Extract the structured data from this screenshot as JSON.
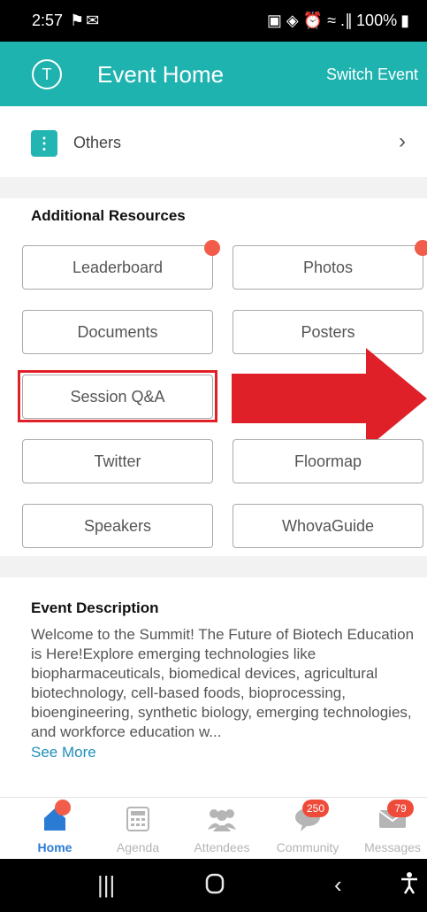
{
  "status_bar": {
    "time": "2:57",
    "left_icons": "⚑✉",
    "right_icons": "▣ ◈ ⏰ ≈ .∥",
    "battery": "100%"
  },
  "header": {
    "avatar_letter": "T",
    "title": "Event Home",
    "switch_label": "Switch Event"
  },
  "others": {
    "label": "Others"
  },
  "resources": {
    "title": "Additional Resources",
    "tiles": [
      "Leaderboard",
      "Photos",
      "Documents",
      "Posters",
      "Session Q&A",
      "Twitter",
      "Floormap",
      "Speakers",
      "WhovaGuide"
    ]
  },
  "description": {
    "title": "Event Description",
    "text": "Welcome to the Summit! The Future of Biotech Education is Here!Explore emerging technologies like biopharmaceuticals, biomedical devices, agricultural biotechnology, cell-based foods, bioprocessing, bioengineering, synthetic biology, emerging technologies, and workforce education w...",
    "see_more": "See More"
  },
  "nav": {
    "items": [
      {
        "label": "Home",
        "icon": "home-icon",
        "active": true
      },
      {
        "label": "Agenda",
        "icon": "calculator-icon"
      },
      {
        "label": "Attendees",
        "icon": "people-icon"
      },
      {
        "label": "Community",
        "icon": "chat-icon",
        "badge": "250"
      },
      {
        "label": "Messages",
        "icon": "envelope-icon",
        "badge": "79"
      }
    ]
  },
  "colors": {
    "accent": "#1fb3b0",
    "highlight_red": "#e02029",
    "badge_red": "#ee4b3b",
    "active_blue": "#2a7bd3"
  }
}
